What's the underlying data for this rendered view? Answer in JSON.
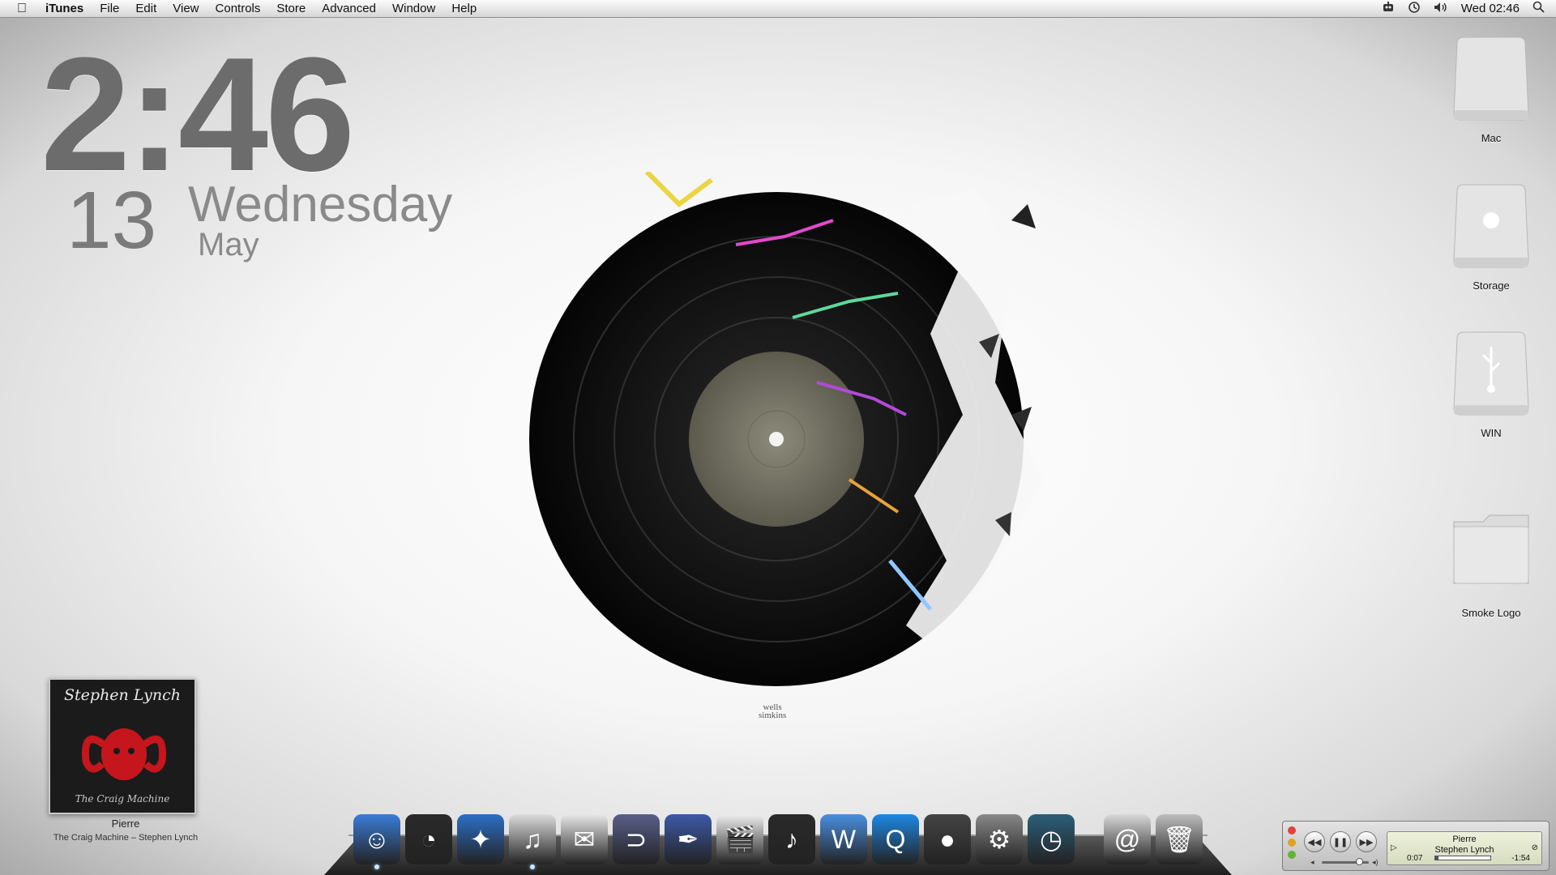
{
  "menubar": {
    "apple_icon": "",
    "app_name": "iTunes",
    "items": [
      "File",
      "Edit",
      "View",
      "Controls",
      "Store",
      "Advanced",
      "Window",
      "Help"
    ],
    "status_icons": [
      "robot-icon",
      "time-machine-icon",
      "volume-icon"
    ],
    "clock": "Wed 02:46",
    "spotlight_icon": "search-icon"
  },
  "clock_widget": {
    "time": "2:46",
    "day_number": "13",
    "weekday": "Wednesday",
    "month": "May"
  },
  "wallpaper": {
    "credit_line1": "wells",
    "credit_line2": "simkins"
  },
  "desktop_icons": [
    {
      "label": "Mac",
      "type": "drive"
    },
    {
      "label": "Storage",
      "type": "apple-drive"
    },
    {
      "label": "WIN",
      "type": "usb-drive"
    },
    {
      "label": "Smoke Logo",
      "type": "folder"
    }
  ],
  "now_playing_widget": {
    "album_art_artist": "Stephen Lynch",
    "album_art_title": "The Craig Machine",
    "track": "Pierre",
    "subtitle": "The Craig Machine – Stephen Lynch"
  },
  "dock": {
    "apps": [
      {
        "name": "finder",
        "icon": "☺",
        "bg": "#3b7dd8",
        "running": true
      },
      {
        "name": "dashboard",
        "icon": "◔",
        "bg": "#2a2a2a",
        "running": false
      },
      {
        "name": "safari",
        "icon": "✦",
        "bg": "#2d6fc7",
        "running": false
      },
      {
        "name": "itunes",
        "icon": "♫",
        "bg": "#dcdcdc",
        "running": true
      },
      {
        "name": "mail",
        "icon": "✉",
        "bg": "#e8e8e8",
        "running": false
      },
      {
        "name": "magnet",
        "icon": "⊃",
        "bg": "#5a5f8a",
        "running": false
      },
      {
        "name": "quill",
        "icon": "✒",
        "bg": "#3d5aa8",
        "running": false
      },
      {
        "name": "final-cut",
        "icon": "🎬",
        "bg": "#eeeeee",
        "running": false
      },
      {
        "name": "garageband",
        "icon": "♪",
        "bg": "#2a2a2a",
        "running": false
      },
      {
        "name": "iwork",
        "icon": "W",
        "bg": "#4a8fe0",
        "running": false
      },
      {
        "name": "quicktime",
        "icon": "Q",
        "bg": "#1e88e5",
        "running": false
      },
      {
        "name": "colors",
        "icon": "●",
        "bg": "#444444",
        "running": false
      },
      {
        "name": "system-preferences",
        "icon": "⚙",
        "bg": "#888888",
        "running": false
      },
      {
        "name": "time-machine",
        "icon": "◷",
        "bg": "#2c5f7a",
        "running": false
      },
      {
        "name": "mail-stack",
        "icon": "@",
        "bg": "#d8d8d8",
        "running": false,
        "gap": true
      },
      {
        "name": "trash",
        "icon": "🗑",
        "bg": "#bdbdbd",
        "running": false
      }
    ]
  },
  "mini_player": {
    "track": "Pierre",
    "artist": "Stephen Lynch",
    "elapsed": "0:07",
    "remaining": "-1:54",
    "progress": 0.06,
    "volume": 0.8
  }
}
